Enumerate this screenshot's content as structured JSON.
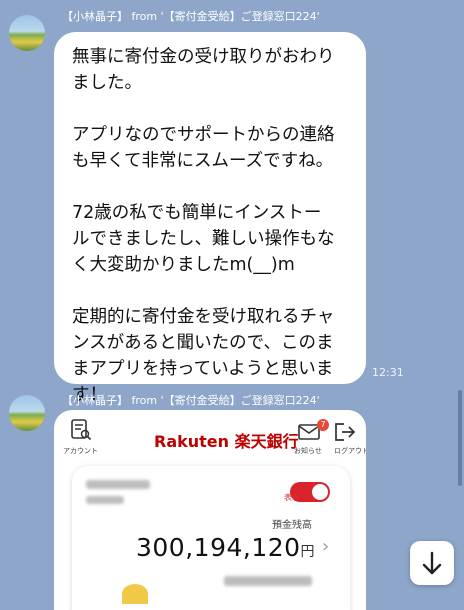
{
  "messages": [
    {
      "sender": "【小林晶子】 from '【寄付金受給】ご登録窓口224'",
      "text": "無事に寄付金の受け取りがおわり\nました。\n\nアプリなのでサポートからの連絡\nも早くて非常にスムーズですね。\n\n72歳の私でも簡単にインストー\nルできましたし、難しい操作もな\nく大変助かりましたm(__)m\n\n定期的に寄付金を受け取れるチャ\nンスがあると聞いたので、このま\nまアプリを持っていようと思いま\nす！",
      "time": "12:31"
    },
    {
      "sender": "【小林晶子】 from '【寄付金受給】ご登録窓口224'"
    }
  ],
  "bank_app": {
    "account_label": "アカウント",
    "brand": "Rakuten 楽天銀行",
    "notifications_label": "お知らせ",
    "notification_count": "7",
    "logout_label": "ログアウト",
    "toggle_label": "表示",
    "balance_label": "預金残高",
    "balance": "300,194,120",
    "currency": "円"
  },
  "icons": {
    "account": "account-icon",
    "mail": "mail-icon",
    "logout": "logout-icon",
    "scroll_down": "arrow-down-icon"
  },
  "colors": {
    "background": "#8da6c9",
    "brand_red": "#bf0000"
  }
}
